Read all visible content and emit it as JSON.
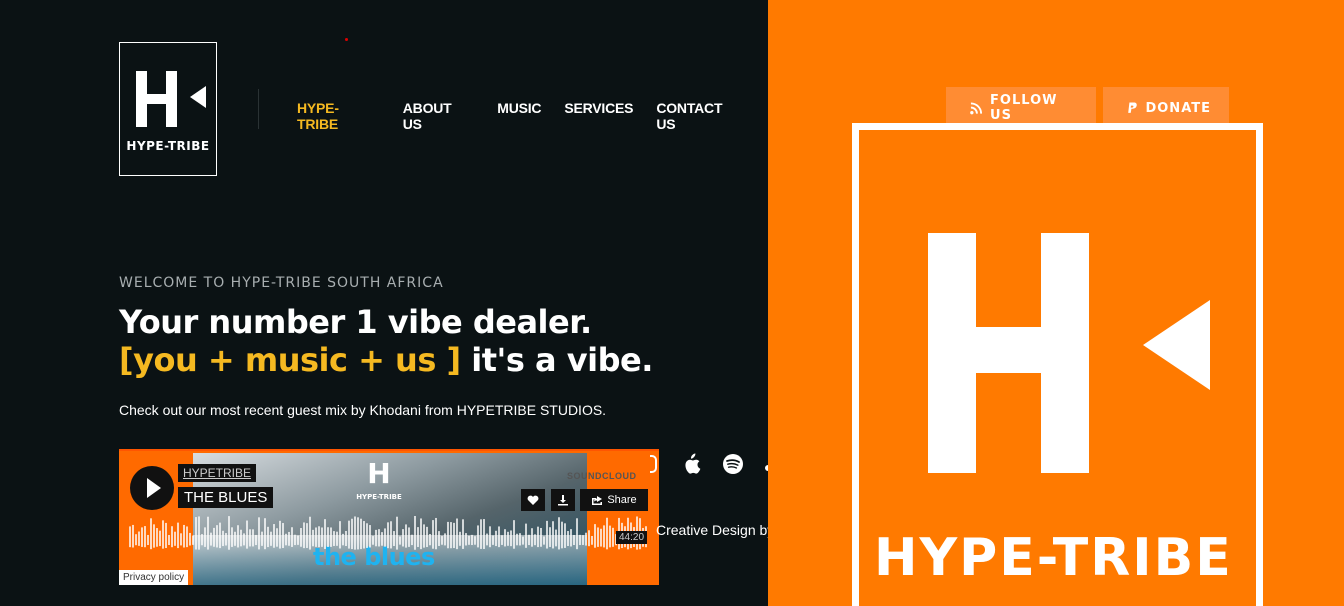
{
  "brand": {
    "logo_text": "HYPE-TRIBE",
    "logo_glyph": "H"
  },
  "nav": {
    "items": [
      {
        "label": "HYPE-TRIBE",
        "active": true
      },
      {
        "label": "ABOUT US",
        "active": false
      },
      {
        "label": "MUSIC",
        "active": false
      },
      {
        "label": "SERVICES",
        "active": false
      },
      {
        "label": "CONTACT US",
        "active": false
      }
    ]
  },
  "hero": {
    "eyebrow": "WELCOME TO HYPE-TRIBE SOUTH AFRICA",
    "headline_line1": "Your number 1 vibe dealer.",
    "headline_accent": "[you + music + us ]",
    "headline_tail": " it's a vibe.",
    "subtext": "Check out our most recent guest mix by Khodani from HYPETRIBE STUDIOS."
  },
  "player": {
    "user": "HYPETRIBE",
    "track": "THE BLUES",
    "brand_label": "SOUNDCLOUD",
    "share_label": "Share",
    "duration": "44:20",
    "privacy_label": "Privacy policy",
    "art_text": "the blues",
    "art_logo_text": "HYPE-TRIBE"
  },
  "platforms": [
    {
      "icon": "apple-icon"
    },
    {
      "icon": "spotify-icon"
    }
  ],
  "credit": "Creative Design by",
  "actions": {
    "follow_label": "FOLLOW US",
    "donate_label": "DONATE"
  },
  "hero_art": {
    "word": "HYPE-TRIBE"
  },
  "colors": {
    "accent": "#f5b921",
    "panel": "#ff7a00",
    "background": "#0b1214"
  }
}
